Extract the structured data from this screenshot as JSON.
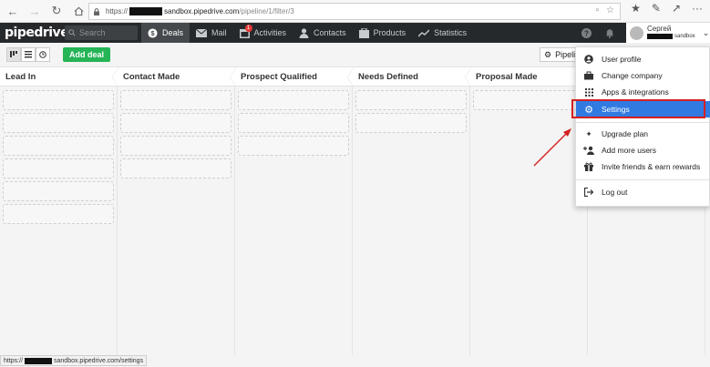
{
  "browser": {
    "url_prefix": "https://",
    "url_host": "sandbox.pipedrive.com",
    "url_path": "/pipeline/1/filter/3"
  },
  "app": {
    "logo": "pipedrive",
    "search_placeholder": "Search",
    "nav": [
      {
        "label": "Deals",
        "icon": "dollar-icon",
        "active": true
      },
      {
        "label": "Mail",
        "icon": "mail-icon"
      },
      {
        "label": "Activities",
        "icon": "calendar-icon",
        "badge": "1"
      },
      {
        "label": "Contacts",
        "icon": "person-icon"
      },
      {
        "label": "Products",
        "icon": "box-icon"
      },
      {
        "label": "Statistics",
        "icon": "trend-icon"
      }
    ],
    "user": {
      "name": "Сергей",
      "company_suffix": "sandbox"
    }
  },
  "toolbar": {
    "add_deal": "Add deal",
    "pipeline": "Pipeline"
  },
  "stages": [
    "Lead In",
    "Contact Made",
    "Prospect Qualified",
    "Needs Defined",
    "Proposal Made"
  ],
  "stage_slots": [
    6,
    4,
    3,
    2,
    1
  ],
  "status_bar": {
    "prefix": "https://",
    "rest": "sandbox.pipedrive.com/settings"
  },
  "menu": {
    "items": [
      {
        "label": "User profile",
        "icon": "user-circle-icon"
      },
      {
        "label": "Change company",
        "icon": "briefcase-icon"
      },
      {
        "label": "Apps & integrations",
        "icon": "grid-icon"
      },
      {
        "label": "Settings",
        "icon": "gear-icon",
        "active": true
      },
      {
        "label": "Upgrade plan",
        "icon": "sparkle-icon"
      },
      {
        "label": "Add more users",
        "icon": "add-user-icon"
      },
      {
        "label": "Invite friends & earn rewards",
        "icon": "gift-icon"
      },
      {
        "label": "Log out",
        "icon": "logout-icon"
      }
    ]
  },
  "colors": {
    "accent": "#317ae2",
    "green": "#25b456",
    "header": "#26292c",
    "annotation": "#d42020"
  }
}
